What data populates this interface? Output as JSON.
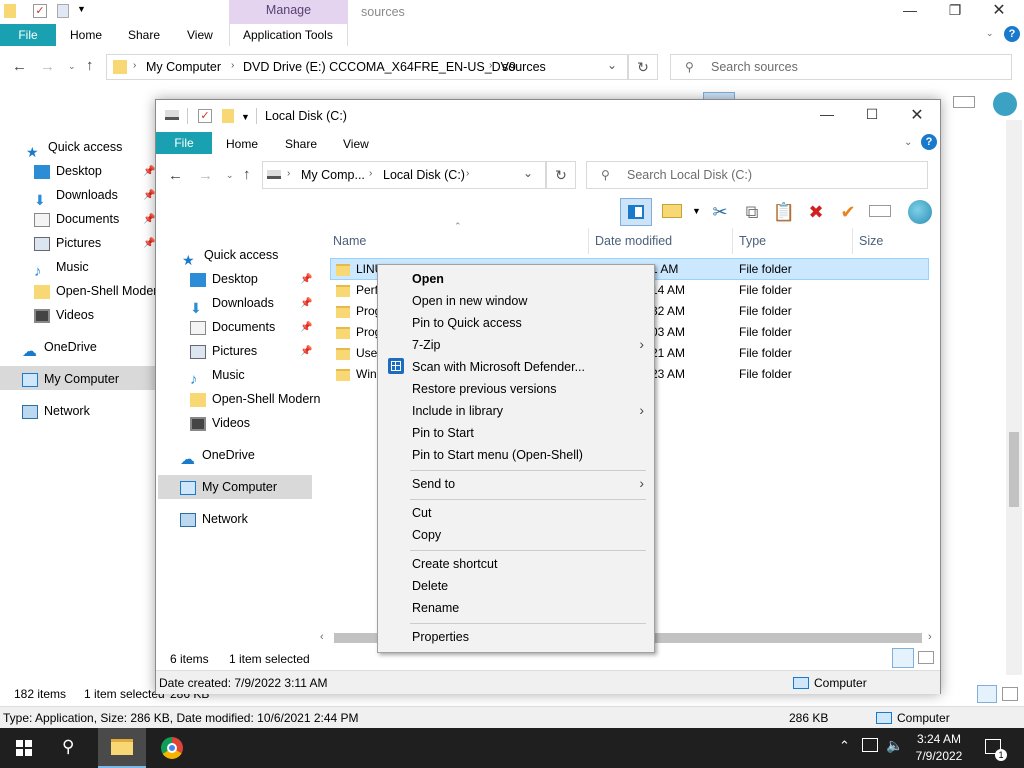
{
  "back_window": {
    "manage_tab": "Manage",
    "title": "sources",
    "tabs": [
      "File",
      "Home",
      "Share",
      "View",
      "Application Tools"
    ],
    "breadcrumb": [
      "My Computer",
      "DVD Drive (E:) CCCOMA_X64FRE_EN-US_DV9",
      "sources"
    ],
    "search_placeholder": "Search sources",
    "nav": [
      "Quick access",
      "Desktop",
      "Downloads",
      "Documents",
      "Pictures",
      "Music",
      "Open-Shell Modern",
      "Videos",
      "OneDrive",
      "My Computer",
      "Network"
    ],
    "status_items": "182 items",
    "status_selected": "1 item selected",
    "status_size": "286 KB",
    "info_bar": "Type: Application, Size: 286 KB, Date modified: 10/6/2021 2:44 PM",
    "info_size": "286 KB",
    "info_location": "Computer"
  },
  "front_window": {
    "title": "Local Disk (C:)",
    "tabs": [
      "File",
      "Home",
      "Share",
      "View"
    ],
    "breadcrumb": [
      "My Comp...",
      "Local Disk (C:)"
    ],
    "search_placeholder": "Search Local Disk (C:)",
    "nav": [
      "Quick access",
      "Desktop",
      "Downloads",
      "Documents",
      "Pictures",
      "Music",
      "Open-Shell Modern",
      "Videos",
      "OneDrive",
      "My Computer",
      "Network"
    ],
    "columns": [
      "Name",
      "Date modified",
      "Type",
      "Size"
    ],
    "rows": [
      {
        "name": "LINU",
        "date": "1 AM",
        "type": "File folder"
      },
      {
        "name": "Perfl",
        "date": "14 AM",
        "type": "File folder"
      },
      {
        "name": "Prog",
        "date": "32 AM",
        "type": "File folder"
      },
      {
        "name": "Prog",
        "date": "03 AM",
        "type": "File folder"
      },
      {
        "name": "User",
        "date": "21 AM",
        "type": "File folder"
      },
      {
        "name": "Wind",
        "date": "23 AM",
        "type": "File folder"
      }
    ],
    "status_items": "6 items",
    "status_selected": "1 item selected",
    "info_bar": "Date created: 7/9/2022 3:11 AM",
    "info_location": "Computer"
  },
  "context_menu": {
    "items": [
      {
        "label": "Open"
      },
      {
        "label": "Open in new window"
      },
      {
        "label": "Pin to Quick access"
      },
      {
        "label": "7-Zip"
      },
      {
        "label": "Scan with Microsoft Defender..."
      },
      {
        "label": "Restore previous versions"
      },
      {
        "label": "Include in library"
      },
      {
        "label": "Pin to Start"
      },
      {
        "label": "Pin to Start menu (Open-Shell)"
      },
      {
        "label": "Send to"
      },
      {
        "label": "Cut"
      },
      {
        "label": "Copy"
      },
      {
        "label": "Create shortcut"
      },
      {
        "label": "Delete"
      },
      {
        "label": "Rename"
      },
      {
        "label": "Properties"
      }
    ]
  },
  "taskbar": {
    "time": "3:24 AM",
    "date": "7/9/2022",
    "notification_count": "1"
  },
  "colors": {
    "accent": "#1979ca",
    "file_tab": "#1aa1b1",
    "selection": "#cce8ff",
    "taskbar": "#1f1f1f"
  }
}
